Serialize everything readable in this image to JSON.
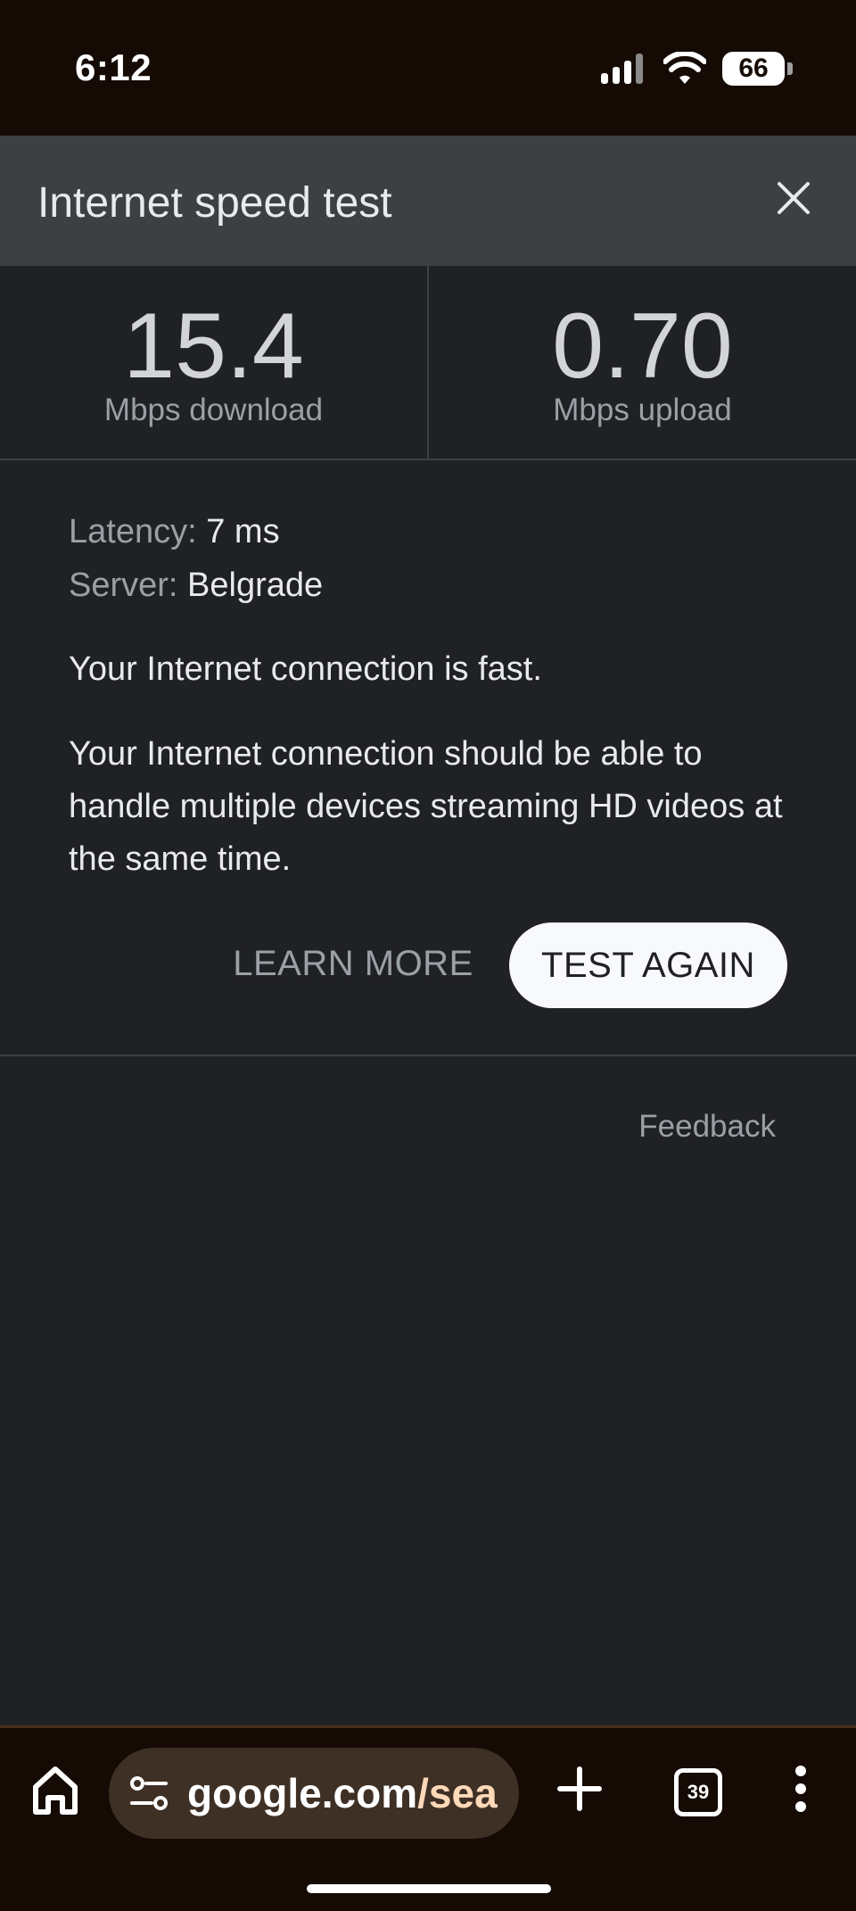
{
  "status_bar": {
    "time": "6:12",
    "battery_level": "66",
    "icons": [
      "signal-icon",
      "wifi-icon",
      "battery-icon"
    ]
  },
  "header": {
    "title": "Internet speed test",
    "close_icon": "close-icon"
  },
  "results": {
    "download": {
      "value": "15.4",
      "unit": "Mbps download"
    },
    "upload": {
      "value": "0.70",
      "unit": "Mbps upload"
    }
  },
  "details": {
    "latency_label": "Latency:",
    "latency_value": "7 ms",
    "server_label": "Server:",
    "server_value": "Belgrade",
    "verdict": "Your Internet connection is fast.",
    "description": "Your Internet connection should be able to handle multiple devices streaming HD videos at the same time."
  },
  "actions": {
    "learn_more": "LEARN MORE",
    "test_again": "TEST AGAIN"
  },
  "feedback": "Feedback",
  "browser_bar": {
    "url_host": "google.com",
    "url_path": "/sea",
    "tab_count": "39",
    "icons": [
      "home-icon",
      "site-settings-icon",
      "new-tab-icon",
      "tab-switcher-icon",
      "more-menu-icon"
    ]
  },
  "colors": {
    "background": "#202124",
    "header": "#3c4043",
    "system_bar": "#150b04",
    "url_pill": "#3f3026",
    "url_path": "#ffd9b8"
  }
}
